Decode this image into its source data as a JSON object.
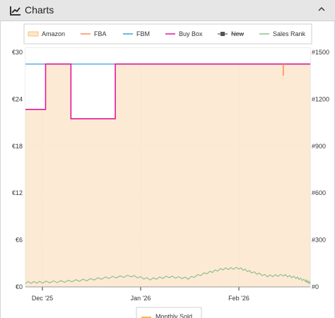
{
  "panel": {
    "title": "Charts",
    "icon": "line-chart-icon",
    "collapse_icon": "chevron-up-icon"
  },
  "chart_data": {
    "type": "line",
    "legend": [
      {
        "name": "Amazon",
        "color": "#f7c37a",
        "style": "area"
      },
      {
        "name": "FBA",
        "color": "#ff8c5a",
        "style": "line"
      },
      {
        "name": "FBM",
        "color": "#3fa0d6",
        "style": "line"
      },
      {
        "name": "Buy Box",
        "color": "#e0199a",
        "style": "line"
      },
      {
        "name": "New",
        "color": "#555555",
        "style": "disabled"
      },
      {
        "name": "Sales Rank",
        "color": "#8fbf8f",
        "style": "line"
      }
    ],
    "bottom_legend": [
      {
        "name": "Monthly Sold",
        "color": "#f5a623"
      }
    ],
    "x_range": [
      "2025-12-01",
      "2026-02-25"
    ],
    "x_ticks": [
      {
        "date": "2025-12-01",
        "label": "Dec '25"
      },
      {
        "date": "2026-01-01",
        "label": "Jan '26"
      },
      {
        "date": "2026-02-01",
        "label": "Feb '26"
      }
    ],
    "y_left": {
      "range": [
        0,
        30
      ],
      "ticks": [
        "€0",
        "€6",
        "€12",
        "€18",
        "€24",
        "€30"
      ],
      "values": [
        0,
        6,
        12,
        18,
        24,
        30
      ]
    },
    "y_right": {
      "range": [
        0,
        1500
      ],
      "ticks": [
        "#0",
        "#300",
        "#600",
        "#900",
        "#1200",
        "#1500"
      ],
      "values": [
        0,
        300,
        600,
        900,
        1200,
        1500
      ]
    },
    "grid": true,
    "series": [
      {
        "name": "Amazon",
        "points": [
          [
            "2025-11-24",
            28.5
          ],
          [
            "2026-02-25",
            28.5
          ]
        ]
      },
      {
        "name": "FBM",
        "points": [
          [
            "2025-11-24",
            28.5
          ],
          [
            "2026-02-25",
            28.5
          ]
        ]
      },
      {
        "name": "Buy Box",
        "points": [
          [
            "2025-11-24",
            22.7
          ],
          [
            "2025-12-02",
            22.7
          ],
          [
            "2025-12-02",
            28.5
          ],
          [
            "2025-12-10",
            28.5
          ],
          [
            "2025-12-10",
            21.5
          ],
          [
            "2025-12-24",
            21.5
          ],
          [
            "2025-12-24",
            28.5
          ],
          [
            "2026-02-25",
            28.5
          ]
        ]
      },
      {
        "name": "FBA",
        "points": [
          [
            "2026-02-15",
            28.5
          ],
          [
            "2026-02-15",
            27.0
          ]
        ]
      },
      {
        "name": "Sales Rank",
        "points": [
          [
            "2025-11-24",
            28
          ],
          [
            "2025-12-01",
            30
          ],
          [
            "2025-12-08",
            35
          ],
          [
            "2025-12-15",
            45
          ],
          [
            "2025-12-22",
            60
          ],
          [
            "2025-12-29",
            70
          ],
          [
            "2026-01-04",
            50
          ],
          [
            "2026-01-10",
            65
          ],
          [
            "2026-01-16",
            55
          ],
          [
            "2026-01-22",
            90
          ],
          [
            "2026-01-27",
            115
          ],
          [
            "2026-02-01",
            120
          ],
          [
            "2026-02-05",
            95
          ],
          [
            "2026-02-10",
            70
          ],
          [
            "2026-02-15",
            75
          ],
          [
            "2026-02-19",
            60
          ],
          [
            "2026-02-22",
            40
          ],
          [
            "2026-02-25",
            25
          ]
        ]
      }
    ]
  }
}
